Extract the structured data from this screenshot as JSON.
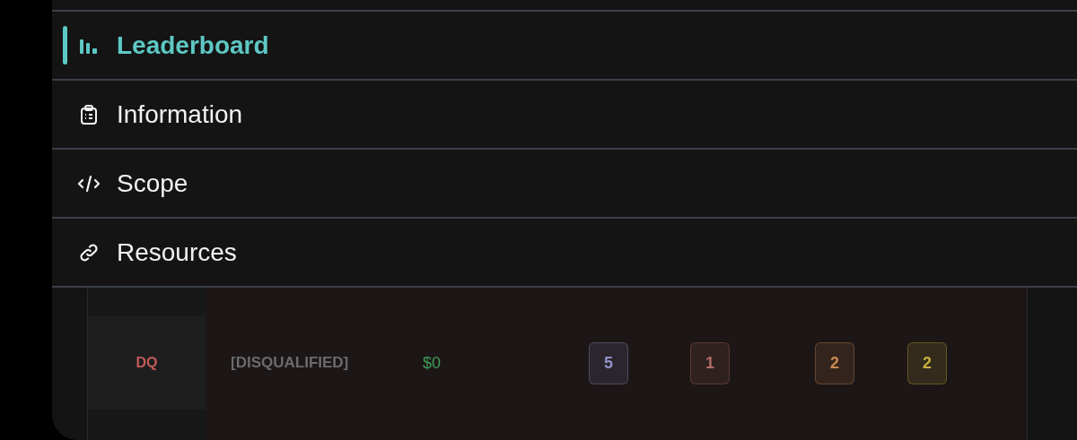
{
  "menu": [
    {
      "label": "Leaderboard",
      "selected": true
    },
    {
      "label": "Information",
      "selected": false
    },
    {
      "label": "Scope",
      "selected": false
    },
    {
      "label": "Resources",
      "selected": false
    }
  ],
  "table": {
    "rows": [
      {
        "rank": "DQ",
        "name": "[DISQUALIFIED]",
        "amount": "$0",
        "badges": [
          {
            "value": "5",
            "color": "#8f92c8"
          },
          {
            "value": "1",
            "color": "#b06a64"
          },
          {
            "value": "2",
            "color": "#cc8a52"
          },
          {
            "value": "2",
            "color": "#c8b23e"
          }
        ]
      }
    ]
  }
}
